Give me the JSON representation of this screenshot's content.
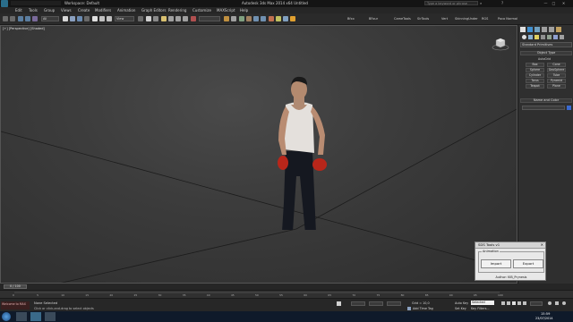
{
  "titlebar": {
    "app_icon": "3ds-max-icon",
    "workspace": "Workspace: Default",
    "title": "Autodesk 3ds Max 2014 x64    Untitled",
    "search_placeholder": "Type a keyword or phrase",
    "minimize": "—",
    "maximize": "□",
    "close": "✕"
  },
  "menu": [
    "Edit",
    "Tools",
    "Group",
    "Views",
    "Create",
    "Modifiers",
    "Animation",
    "Graph Editors",
    "Rendering",
    "Customize",
    "MAXScript",
    "Help"
  ],
  "toolbar": {
    "selection_filter": "All",
    "coordinate_system": "View",
    "tabs": [
      "Bfxx",
      "BFour",
      "CameTools",
      "SirTools",
      "Vert",
      "SkinningUnder",
      "RGS",
      "Poco Normal"
    ]
  },
  "viewport": {
    "label": "[+] [Perspective] [Shaded]"
  },
  "command_panel": {
    "object_category": "Standard Primitives",
    "object_type_header": "Object Type",
    "autogrid_label": "AutoGrid",
    "buttons": [
      "Box",
      "Cone",
      "Sphere",
      "GeoSphere",
      "Cylinder",
      "Tube",
      "Torus",
      "Pyramid",
      "Teapot",
      "Plane"
    ],
    "name_color_header": "Name and Color"
  },
  "timeline": {
    "frame_counter": "0 / 100",
    "ticks": [
      "0",
      "5",
      "10",
      "15",
      "20",
      "25",
      "30",
      "35",
      "40",
      "45",
      "50",
      "55",
      "60",
      "65",
      "70",
      "75",
      "80",
      "85",
      "90",
      "95",
      "100"
    ]
  },
  "status": {
    "selection": "None Selected",
    "prompt": "Click or click-and-drag to select objects",
    "welcome": "Welcome to MAX",
    "grid": "Grid = 10,0",
    "add_time_tag": "Add Time Tag",
    "auto_key": "Auto Key",
    "selected": "Selected",
    "set_key": "Set Key",
    "key_filters": "Key Filters..."
  },
  "sds_tools": {
    "title": "SDS Tools v1",
    "group_label": "Animation",
    "import_label": "Import",
    "export_label": "Export",
    "author": "Author: KIB_Prynesis"
  },
  "taskbar": {
    "time": "15:59",
    "date": "23/07/2014"
  }
}
